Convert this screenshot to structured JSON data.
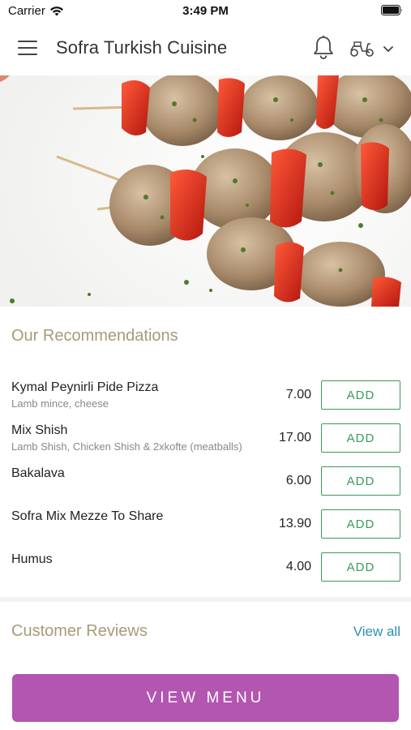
{
  "status_bar": {
    "carrier": "Carrier",
    "time": "3:49 PM"
  },
  "navbar": {
    "title": "Sofra Turkish Cuisine"
  },
  "hero": {
    "alt": "Chicken shish skewers with red peppers"
  },
  "recommendations": {
    "title": "Our Recommendations",
    "items": [
      {
        "name": "Kymal Peynirli Pide Pizza",
        "description": "Lamb mince, cheese",
        "price": "7.00",
        "button": "ADD"
      },
      {
        "name": "Mix Shish",
        "description": "Lamb Shish, Chicken Shish & 2xkofte (meatballs)",
        "price": "17.00",
        "button": "ADD"
      },
      {
        "name": "Bakalava",
        "description": "",
        "price": "6.00",
        "button": "ADD"
      },
      {
        "name": "Sofra Mix Mezze To Share",
        "description": "",
        "price": "13.90",
        "button": "ADD"
      },
      {
        "name": "Humus",
        "description": "",
        "price": "4.00",
        "button": "ADD"
      }
    ]
  },
  "reviews": {
    "title": "Customer Reviews",
    "view_all": "View all"
  },
  "cta": {
    "label": "VIEW MENU"
  },
  "colors": {
    "accent_purple": "#b256b2",
    "add_green": "#3a9a5a",
    "section_title": "#a89a7a",
    "link_blue": "#2a8fb0"
  }
}
